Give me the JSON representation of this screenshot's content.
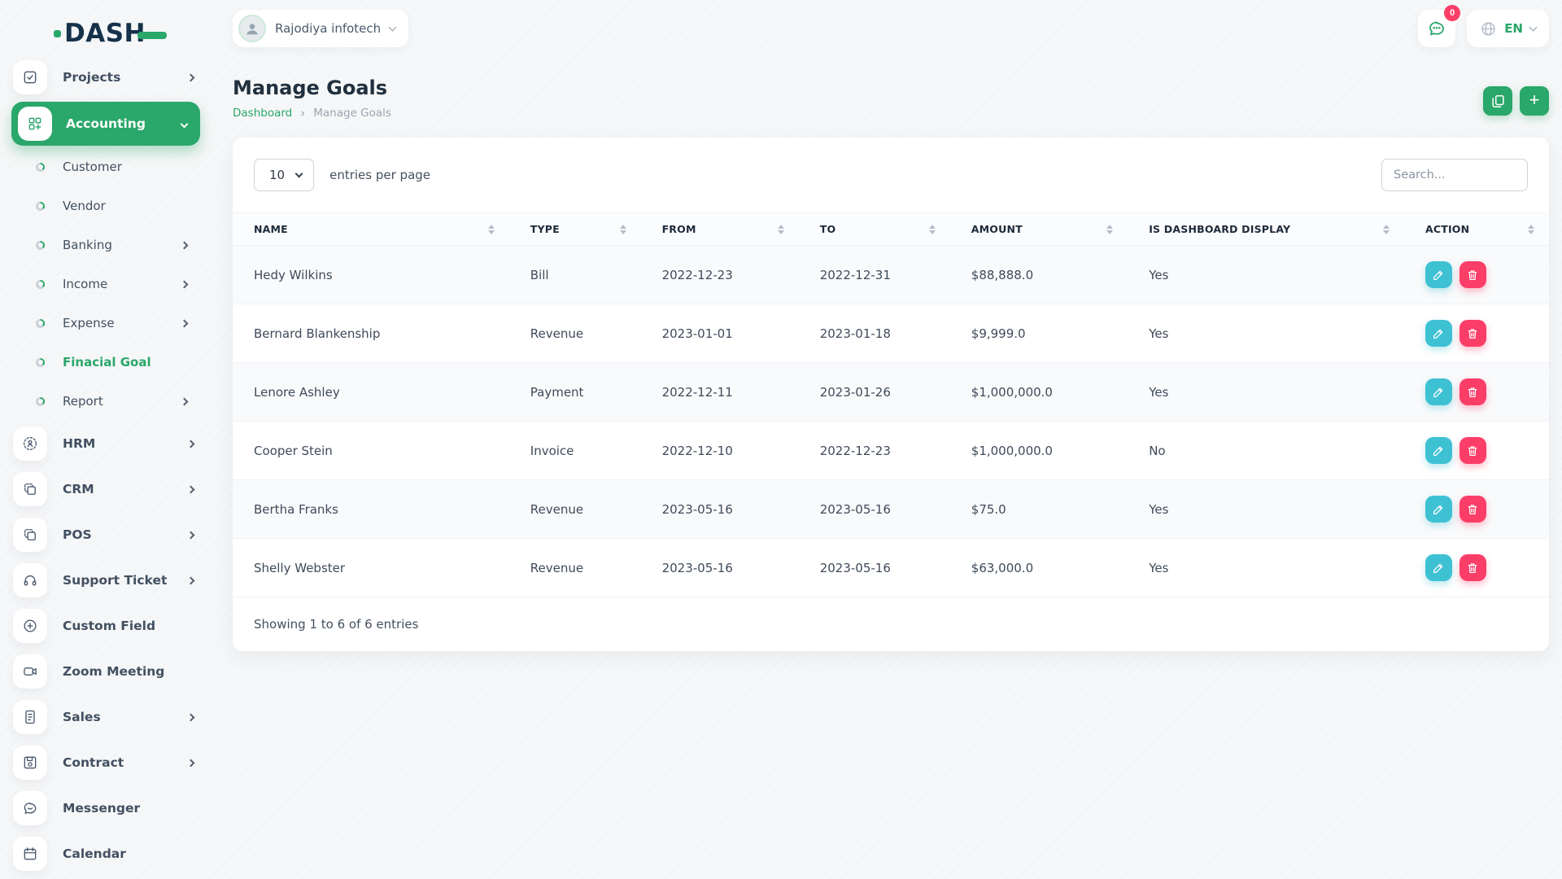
{
  "app": {
    "logo_text": "DASH"
  },
  "header": {
    "company_name": "Rajodiya infotech",
    "message_badge": "0",
    "language": "EN"
  },
  "sidebar": {
    "items": [
      {
        "label": "Projects",
        "icon": "tasks-icon"
      },
      {
        "label": "Accounting",
        "icon": "modules-icon",
        "active": true,
        "expanded": true
      },
      {
        "label": "Customer"
      },
      {
        "label": "Vendor"
      },
      {
        "label": "Banking"
      },
      {
        "label": "Income"
      },
      {
        "label": "Expense"
      },
      {
        "label": "Finacial Goal",
        "active": true
      },
      {
        "label": "Report"
      },
      {
        "label": "HRM",
        "icon": "hrm-icon"
      },
      {
        "label": "CRM",
        "icon": "copy-icon"
      },
      {
        "label": "POS",
        "icon": "copy-icon"
      },
      {
        "label": "Support Ticket",
        "icon": "headset-icon"
      },
      {
        "label": "Custom Field",
        "icon": "plus-circle-icon"
      },
      {
        "label": "Zoom Meeting",
        "icon": "video-icon"
      },
      {
        "label": "Sales",
        "icon": "document-icon"
      },
      {
        "label": "Contract",
        "icon": "save-icon"
      },
      {
        "label": "Messenger",
        "icon": "chat-icon"
      },
      {
        "label": "Calendar",
        "icon": "calendar-icon"
      }
    ]
  },
  "page": {
    "title": "Manage Goals",
    "breadcrumb_home": "Dashboard",
    "breadcrumb_separator": "›",
    "breadcrumb_current": "Manage Goals"
  },
  "toolbar": {
    "add_label": "+"
  },
  "controls": {
    "entries_value": "10",
    "entries_label": "entries per page",
    "search_placeholder": "Search..."
  },
  "table": {
    "columns": [
      "NAME",
      "TYPE",
      "FROM",
      "TO",
      "AMOUNT",
      "IS DASHBOARD DISPLAY",
      "ACTION"
    ],
    "rows": [
      {
        "name": "Hedy Wilkins",
        "type": "Bill",
        "from": "2022-12-23",
        "to": "2022-12-31",
        "amount": "$88,888.0",
        "dashboard": "Yes"
      },
      {
        "name": "Bernard Blankenship",
        "type": "Revenue",
        "from": "2023-01-01",
        "to": "2023-01-18",
        "amount": "$9,999.0",
        "dashboard": "Yes"
      },
      {
        "name": "Lenore Ashley",
        "type": "Payment",
        "from": "2022-12-11",
        "to": "2023-01-26",
        "amount": "$1,000,000.0",
        "dashboard": "Yes"
      },
      {
        "name": "Cooper Stein",
        "type": "Invoice",
        "from": "2022-12-10",
        "to": "2022-12-23",
        "amount": "$1,000,000.0",
        "dashboard": "No"
      },
      {
        "name": "Bertha Franks",
        "type": "Revenue",
        "from": "2023-05-16",
        "to": "2023-05-16",
        "amount": "$75.0",
        "dashboard": "Yes"
      },
      {
        "name": "Shelly Webster",
        "type": "Revenue",
        "from": "2023-05-16",
        "to": "2023-05-16",
        "amount": "$63,000.0",
        "dashboard": "Yes"
      }
    ],
    "footer": "Showing 1 to 6 of 6 entries"
  },
  "colors": {
    "primary": "#2aa76a",
    "edit": "#3ec1d3",
    "delete": "#fb3e68",
    "logo": "#16324a"
  }
}
